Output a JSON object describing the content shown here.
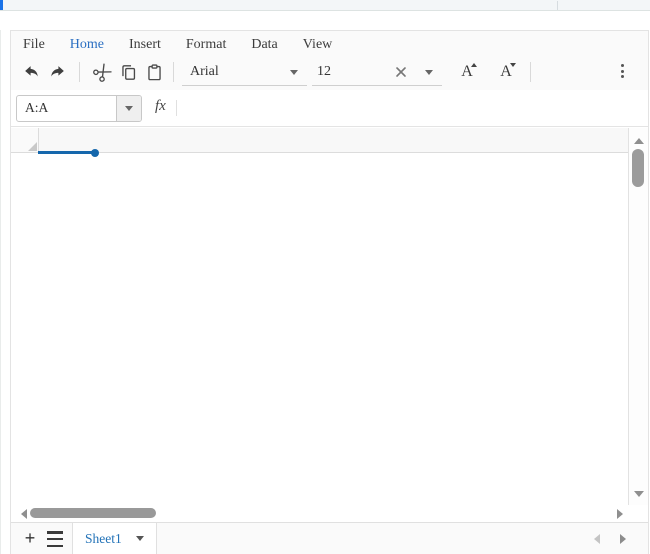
{
  "window": {
    "top_strip": {
      "active_tab_marker_color": "#1a73e8"
    }
  },
  "menu_bar": {
    "items": [
      {
        "label": "File",
        "active": false
      },
      {
        "label": "Home",
        "active": true
      },
      {
        "label": "Insert",
        "active": false
      },
      {
        "label": "Format",
        "active": false
      },
      {
        "label": "Data",
        "active": false
      },
      {
        "label": "View",
        "active": false
      }
    ]
  },
  "toolbar": {
    "font_family": {
      "value": "Arial"
    },
    "font_size": {
      "value": "12"
    },
    "increase_font_label": "A",
    "decrease_font_label": "A",
    "icons": [
      "undo-icon",
      "redo-icon",
      "cut-icon",
      "copy-icon",
      "paste-icon",
      "clear-icon",
      "font-increase-icon",
      "font-decrease-icon",
      "more-options-icon"
    ]
  },
  "formula_bar": {
    "name_box_value": "A:A",
    "fx_label": "fx",
    "formula_input_value": ""
  },
  "grid": {
    "selected_range": "A:A",
    "selection_color": "#1567ac",
    "column_header_bg": "#f8f8f8"
  },
  "sheet_bar": {
    "add_sheet_label": "+",
    "sheet_tabs": [
      {
        "name": "Sheet1",
        "active": true
      }
    ]
  },
  "colors": {
    "accent_blue": "#2b6fc2",
    "sheet_tab_blue": "#2373b8",
    "selection_blue": "#1567ac",
    "chrome_bg": "#fafafa",
    "border": "#e0e0e0",
    "icon_gray": "#555555",
    "scroll_thumb": "#9b9b9b"
  }
}
